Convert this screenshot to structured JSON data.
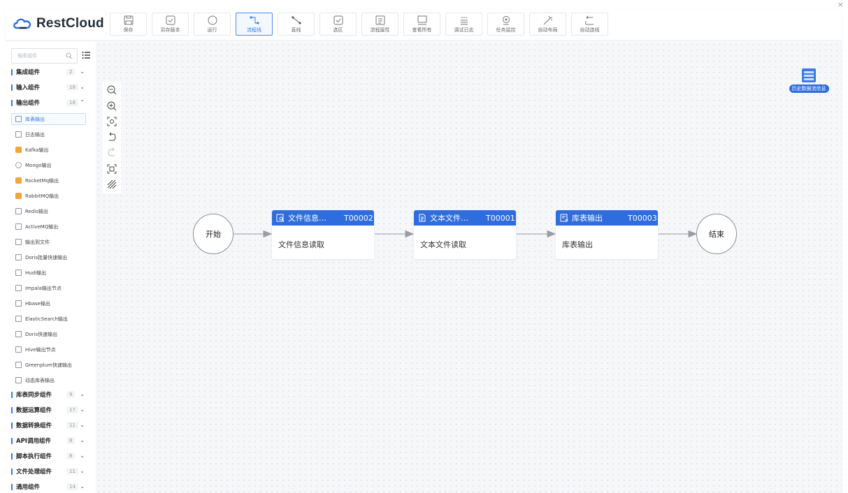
{
  "window": {
    "close_label": "×"
  },
  "app": {
    "name": "RestCloud"
  },
  "toolbar": [
    {
      "label": "保存",
      "icon": "save-icon",
      "active": false
    },
    {
      "label": "另存版本",
      "icon": "save-version-icon",
      "active": false
    },
    {
      "label": "运行",
      "icon": "run-icon",
      "active": false
    },
    {
      "label": "流程线",
      "icon": "flow-line-icon",
      "active": true
    },
    {
      "label": "直线",
      "icon": "straight-line-icon",
      "active": false
    },
    {
      "label": "选区",
      "icon": "select-area-icon",
      "active": false
    },
    {
      "label": "流程属性",
      "icon": "flow-properties-icon",
      "active": false
    },
    {
      "label": "查看所有",
      "icon": "view-all-icon",
      "active": false
    },
    {
      "label": "调试日志",
      "icon": "debug-log-icon",
      "active": false
    },
    {
      "label": "任务监控",
      "icon": "task-monitor-icon",
      "active": false
    },
    {
      "label": "自动布局",
      "icon": "auto-layout-icon",
      "active": false
    },
    {
      "label": "自动连线",
      "icon": "auto-connect-icon",
      "active": false
    }
  ],
  "sidebar": {
    "search_placeholder": "搜索组件",
    "groups_top": [
      {
        "label": "集成组件",
        "count": "2",
        "expanded": false
      },
      {
        "label": "输入组件",
        "count": "18",
        "expanded": false
      },
      {
        "label": "输出组件",
        "count": "18",
        "expanded": true
      }
    ],
    "output_items": [
      {
        "label": "库表输出",
        "selected": true
      },
      {
        "label": "日志输出"
      },
      {
        "label": "Kafka输出"
      },
      {
        "label": "Mongo输出"
      },
      {
        "label": "RocketMq输出"
      },
      {
        "label": "RabbitMQ输出"
      },
      {
        "label": "Redis输出"
      },
      {
        "label": "ActiveMQ输出"
      },
      {
        "label": "输出到文件"
      },
      {
        "label": "Doris批量快速输出"
      },
      {
        "label": "Hudi输出"
      },
      {
        "label": "Impala输出节点"
      },
      {
        "label": "Hbase输出"
      },
      {
        "label": "ElasticSearch输出"
      },
      {
        "label": "Doris快速输出"
      },
      {
        "label": "Hive输出节点"
      },
      {
        "label": "Greenplum快速输出"
      },
      {
        "label": "动态库表输出"
      }
    ],
    "groups_bottom": [
      {
        "label": "库表同步组件",
        "count": "9"
      },
      {
        "label": "数据运算组件",
        "count": "17"
      },
      {
        "label": "数据转换组件",
        "count": "11"
      },
      {
        "label": "API调用组件",
        "count": "8"
      },
      {
        "label": "脚本执行组件",
        "count": "8"
      },
      {
        "label": "文件处理组件",
        "count": "11"
      },
      {
        "label": "通用组件",
        "count": "14"
      }
    ]
  },
  "canvas_tools": [
    "zoom-out-icon",
    "zoom-in-icon",
    "fit-view-icon",
    "undo-icon",
    "redo-icon",
    "focus-icon",
    "grid-toggle-icon"
  ],
  "history_button": {
    "label": "历史数据流信息"
  },
  "flow": {
    "start_label": "开始",
    "end_label": "结束",
    "nodes": [
      {
        "title": "文件信息…",
        "code": "T00002",
        "body": "文件信息读取"
      },
      {
        "title": "文本文件…",
        "code": "T00001",
        "body": "文本文件读取"
      },
      {
        "title": "库表输出",
        "code": "T00003",
        "body": "库表输出"
      }
    ]
  },
  "colors": {
    "accent": "#2f6ddf",
    "active_border": "#4a8af4"
  }
}
